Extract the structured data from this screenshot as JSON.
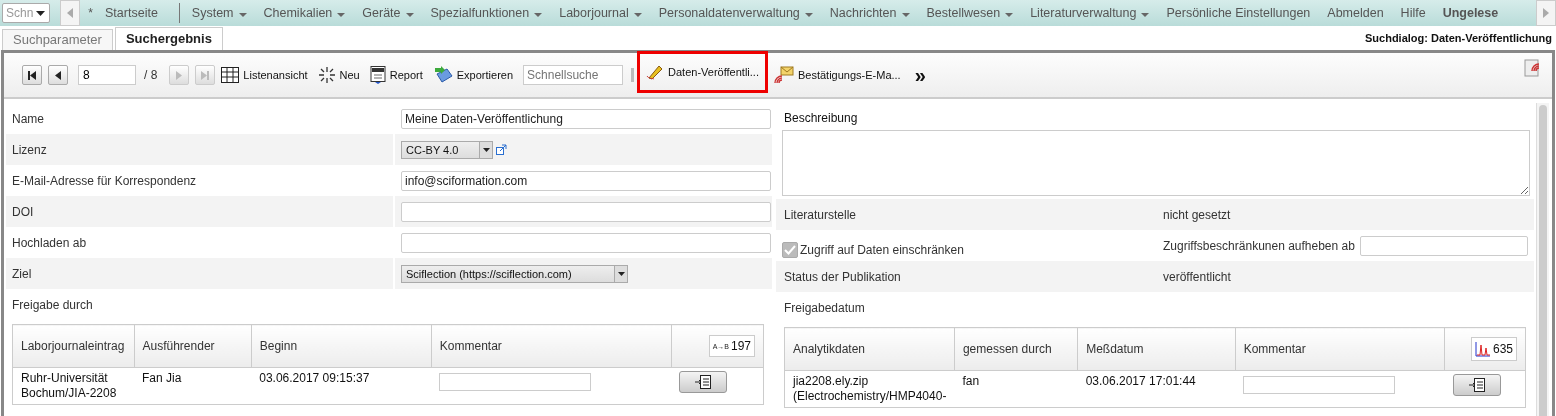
{
  "nav": {
    "search_placeholder": "Schn",
    "star": "*",
    "items": [
      {
        "label": "Startseite",
        "dropdown": false,
        "bold": false
      },
      {
        "label": "System",
        "dropdown": true,
        "bold": false
      },
      {
        "label": "Chemikalien",
        "dropdown": true,
        "bold": false
      },
      {
        "label": "Geräte",
        "dropdown": true,
        "bold": false
      },
      {
        "label": "Spezialfunktionen",
        "dropdown": true,
        "bold": false
      },
      {
        "label": "Laborjournal",
        "dropdown": true,
        "bold": false
      },
      {
        "label": "Personaldatenverwaltung",
        "dropdown": true,
        "bold": false
      },
      {
        "label": "Nachrichten",
        "dropdown": true,
        "bold": false
      },
      {
        "label": "Bestellwesen",
        "dropdown": true,
        "bold": false
      },
      {
        "label": "Literaturverwaltung",
        "dropdown": true,
        "bold": false
      },
      {
        "label": "Persönliche Einstellungen",
        "dropdown": false,
        "bold": false
      },
      {
        "label": "Abmelden",
        "dropdown": false,
        "bold": false
      },
      {
        "label": "Hilfe",
        "dropdown": false,
        "bold": false
      },
      {
        "label": "Ungelese",
        "dropdown": false,
        "bold": true
      }
    ]
  },
  "tabs": [
    {
      "label": "Suchparameter",
      "selected": false
    },
    {
      "label": "Suchergebnis",
      "selected": true
    }
  ],
  "dialog_title": "Suchdialog: Daten-Veröffentlichung",
  "toolbar": {
    "record": "8",
    "total": "/ 8",
    "list_view": "Listenansicht",
    "new": "Neu",
    "report": "Report",
    "export": "Exportieren",
    "quick_search_placeholder": "Schnellsuche",
    "publish": "Daten-Veröffentli...",
    "confirm_mail": "Bestätigungs-E-Ma...",
    "more": "»"
  },
  "left_fields": [
    {
      "kind": "input",
      "label": "Name",
      "value": "Meine Daten-Veröffentlichung"
    },
    {
      "kind": "select",
      "label": "Lizenz",
      "value": "CC-BY 4.0"
    },
    {
      "kind": "input",
      "label": "E-Mail-Adresse für Korrespondenz",
      "value": "info@sciformation.com"
    },
    {
      "kind": "input",
      "label": "DOI"
    },
    {
      "kind": "input",
      "label": "Hochladen ab"
    },
    {
      "kind": "select",
      "label": "Ziel",
      "value": "Sciflection (https://sciflection.com)"
    },
    {
      "kind": "text",
      "label": "Freigabe durch"
    }
  ],
  "description": {
    "label": "Beschreibung"
  },
  "right_fields": [
    {
      "kind": "text",
      "label": "Literaturstelle",
      "value": "nicht gesetzt"
    },
    {
      "kind": "checkbox",
      "label": "Zugriff auf Daten einschränken",
      "checked": true,
      "disabled": true,
      "side_label": "Zugriffsbeschränkunen aufheben ab"
    },
    {
      "kind": "text",
      "label": "Status der Publikation",
      "value": "veröffentlicht"
    },
    {
      "kind": "text",
      "label": "Freigabedatum"
    }
  ],
  "tables": [
    {
      "kind": "reaction",
      "icon_text": "A→B",
      "count": "197",
      "columns": [
        "Laborjournaleintrag",
        "Ausführender",
        "Beginn",
        "Kommentar"
      ],
      "rows": [
        [
          "Ruhr-Universität Bochum/JIA-2208",
          "Fan Jia",
          "03.06.2017 09:15:37"
        ]
      ]
    },
    {
      "kind": "spectrum",
      "count": "635",
      "columns": [
        "Analytikdaten",
        "gemessen durch",
        "Meßdatum",
        "Kommentar"
      ],
      "rows": [
        [
          "jia2208.ely.zip (Electrochemistry/HMP4040-",
          "fan",
          "03.06.2017 17:01:44"
        ]
      ]
    }
  ]
}
